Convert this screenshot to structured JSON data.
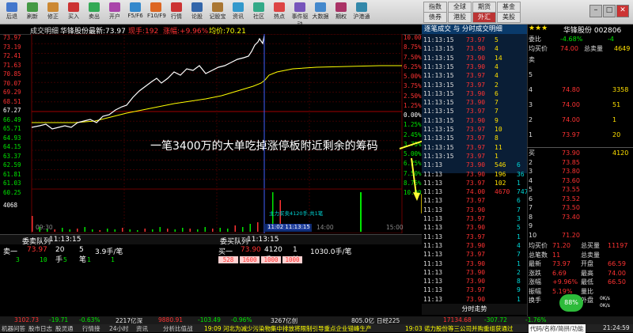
{
  "toolbar": {
    "buttons": [
      "后退",
      "刷新",
      "修正",
      "买入",
      "卖出",
      "开户",
      "F5/F6",
      "F10/F9",
      "行情",
      "论股",
      "记股宝",
      "资讯",
      "社区",
      "热点",
      "事件驱动",
      "大数据",
      "期权",
      "沪港通"
    ],
    "markets": [
      [
        "指数",
        "全球",
        "期货",
        "基金"
      ],
      [
        "债券",
        "港股",
        "外汇",
        "美股"
      ]
    ]
  },
  "chart": {
    "top_title": "成交明细",
    "stock": "华锋股份",
    "newest_label": "最新:73.97",
    "hand_label": "现手:192",
    "rise_label": "涨幅:+9.96%",
    "avg_label": "均价:70.21",
    "left_prices": [
      "73.97",
      "73.19",
      "72.41",
      "71.63",
      "70.85",
      "70.07",
      "69.29",
      "68.51",
      "67.27",
      "66.49",
      "65.71",
      "64.93",
      "64.15",
      "63.37",
      "62.59",
      "61.81",
      "61.03",
      "60.25"
    ],
    "right_pcts": [
      "10.00%",
      "8.75%",
      "7.50%",
      "6.25%",
      "5.00%",
      "3.75%",
      "2.50%",
      "1.25%",
      "0.00%",
      "1.25%",
      "2.45%",
      "3.75%",
      "5.00%",
      "6.25%",
      "7.50%",
      "8.75%",
      "10.00%"
    ],
    "vol_label": "4068",
    "time_ticks": [
      "09:30",
      "11:02 11:13:15",
      "14:00",
      "15:00"
    ],
    "tooltip": "主力买卖4120手,共1笔",
    "annotation": "一笔3400万的大单吃掉涨停板附近剩余的筹码"
  },
  "queue_left": {
    "title": "委卖队列",
    "time": "11:13:15",
    "label": "卖一",
    "price": "73.97",
    "hands": "20手",
    "count": "5笔",
    "avg": "3.9手/笔",
    "values": [
      "3",
      "10",
      "5",
      "1",
      "1"
    ]
  },
  "queue_right": {
    "title": "委买队列",
    "time": "11:13:15",
    "label": "买一",
    "price": "73.90",
    "hands": "4120手",
    "count": "1笔",
    "avg": "1030.0手/笔",
    "values": [
      "528",
      "1600",
      "1000",
      "1000"
    ]
  },
  "trade_list": {
    "title": "逐笔成交 与 分时成交明细",
    "rows": [
      [
        "11:13:15",
        "73.97",
        "5",
        ""
      ],
      [
        "11:13:15",
        "73.90",
        "4",
        ""
      ],
      [
        "11:13:15",
        "73.90",
        "14",
        ""
      ],
      [
        "11:13:15",
        "73.90",
        "4",
        ""
      ],
      [
        "11:13:15",
        "73.97",
        "4",
        ""
      ],
      [
        "11:13:15",
        "73.97",
        "2",
        ""
      ],
      [
        "11:13:15",
        "73.90",
        "6",
        ""
      ],
      [
        "11:13:15",
        "73.90",
        "7",
        ""
      ],
      [
        "11:13:15",
        "73.97",
        "7",
        ""
      ],
      [
        "11:13:15",
        "73.90",
        "9",
        ""
      ],
      [
        "11:13:15",
        "73.97",
        "10",
        ""
      ],
      [
        "11:13:15",
        "73.97",
        "8",
        ""
      ],
      [
        "11:13:15",
        "73.97",
        "11",
        ""
      ],
      [
        "11:13:15",
        "73.97",
        "1",
        ""
      ],
      [
        "11:13",
        "73.90",
        "546",
        "6"
      ],
      [
        "11:13",
        "73.90",
        "196",
        "36"
      ],
      [
        "11:13",
        "73.97",
        "102",
        "1"
      ],
      [
        "11:13",
        "74.00",
        "4670",
        "747"
      ],
      [
        "11:13",
        "73.97",
        "",
        "6"
      ],
      [
        "11:13",
        "73.90",
        "",
        "7"
      ],
      [
        "11:13",
        "73.97",
        "",
        "3"
      ],
      [
        "11:13",
        "73.90",
        "",
        "5"
      ],
      [
        "11:13",
        "73.97",
        "",
        "1"
      ],
      [
        "11:13",
        "73.90",
        "",
        "4"
      ],
      [
        "11:13",
        "73.97",
        "",
        "7"
      ],
      [
        "11:13",
        "73.90",
        "",
        "1"
      ],
      [
        "11:13",
        "73.90",
        "",
        "2"
      ],
      [
        "11:13",
        "73.90",
        "",
        "8"
      ],
      [
        "11:13",
        "73.97",
        "",
        "9"
      ],
      [
        "11:13",
        "73.90",
        "",
        "1"
      ]
    ],
    "footer": "分时走势"
  },
  "info": {
    "title": "华锋股份 002806",
    "stars": "★★★",
    "weibi_label": "委比",
    "weibi": "-4.68%",
    "weicha": "-4",
    "junjia_label": "均买价",
    "junjia": "74.00",
    "zongliang_label": "总卖量",
    "zongliang": "4649",
    "sell_rows": [
      [
        "卖",
        "",
        ""
      ],
      [
        "5",
        "",
        ""
      ],
      [
        "4",
        "74.80",
        "3358"
      ],
      [
        "3",
        "74.00",
        "51"
      ],
      [
        "2",
        "74.00",
        "1"
      ],
      [
        "1",
        "73.97",
        "20"
      ]
    ],
    "buy_rows": [
      [
        "买",
        "73.90",
        "4120"
      ],
      [
        "2",
        "73.85",
        ""
      ],
      [
        "3",
        "73.80",
        ""
      ],
      [
        "4",
        "73.60",
        ""
      ],
      [
        "5",
        "73.55",
        ""
      ],
      [
        "6",
        "73.52",
        ""
      ],
      [
        "7",
        "73.50",
        ""
      ],
      [
        "8",
        "73.40",
        ""
      ],
      [
        "9",
        "",
        ""
      ],
      [
        "10",
        "71.20",
        ""
      ]
    ],
    "stats": [
      [
        "均买价",
        "71.20",
        "总买量",
        "11197"
      ],
      [
        "总笔数",
        "11",
        "总卖量",
        ""
      ],
      [
        "最新",
        "73.97",
        "开盘",
        "66.59"
      ],
      [
        "涨跌",
        "6.69",
        "最高",
        "74.00"
      ],
      [
        "涨幅",
        "+9.96%",
        "最低",
        "66.50"
      ],
      [
        "振幅",
        "5.19%",
        "量比",
        ""
      ],
      [
        "换手",
        "",
        "外盘",
        ""
      ]
    ]
  },
  "status": {
    "sh": "3102.73",
    "sh_chg": "-19.71",
    "sh_pct": "-0.63%",
    "sh_amt": "2217亿深",
    "sz": "9880.91",
    "sz_chg": "-103.49",
    "sz_pct": "-0.96%",
    "sz_amt": "3267亿创",
    "cy": "805.0亿",
    "cy_label": "日经225",
    "nk": "17134.68",
    "nk_chg": "-307.72",
    "nk_pct": "-1.76%",
    "ticker1": "19:09 河北为减少污染物集中排放将限制引导重点企业错峰生产",
    "ticker2": "19:03 诺力股份等三公司并购重组获通过",
    "menu": "代码/名称/简拼/功能",
    "clock": "21:24:59",
    "nav": [
      "机器问答",
      "股市日志",
      "股灵通",
      "行情接",
      "24小时",
      "资讯",
      "分析比值战"
    ],
    "gauge": "88%",
    "net1": "0K/s",
    "net2": "0K/s"
  }
}
